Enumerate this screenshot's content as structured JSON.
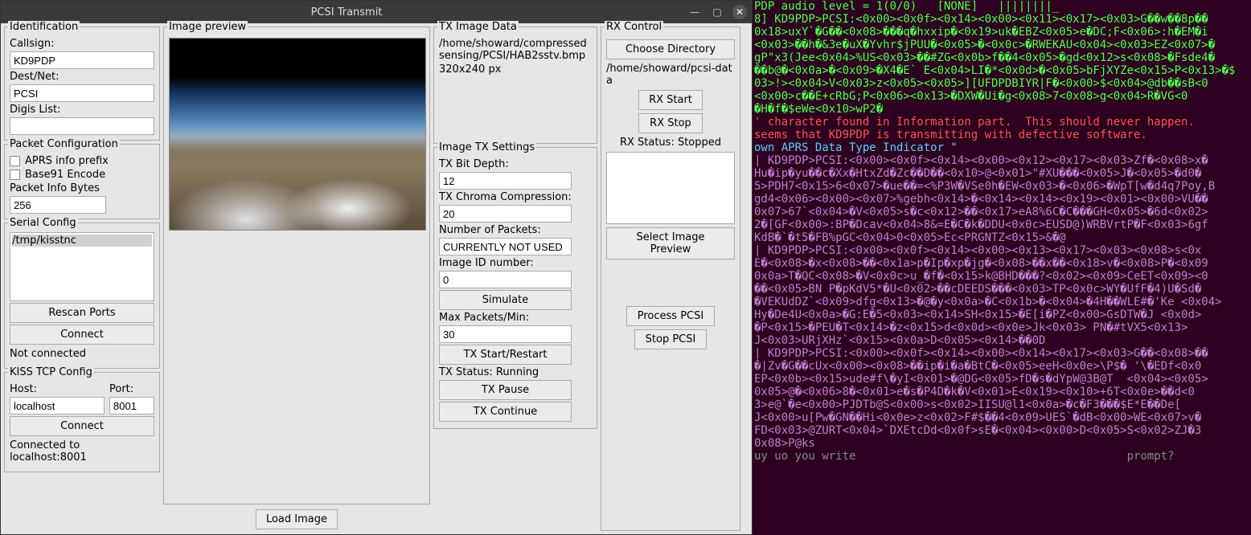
{
  "window": {
    "title": "PCSI Transmit",
    "min_icon": "—",
    "max_icon": "▢",
    "close_icon": "✕"
  },
  "identification": {
    "legend": "Identification",
    "callsign_label": "Callsign:",
    "callsign_value": "KD9PDP",
    "dest_label": "Dest/Net:",
    "dest_value": "PCSI",
    "digis_label": "Digis List:",
    "digis_value": ""
  },
  "packet_config": {
    "legend": "Packet Configuration",
    "aprs_prefix_label": "APRS info prefix",
    "aprs_prefix_checked": false,
    "base91_label": "Base91 Encode",
    "base91_checked": false,
    "info_bytes_label": "Packet Info Bytes",
    "info_bytes_value": "256"
  },
  "serial": {
    "legend": "Serial Config",
    "ports": [
      "/tmp/kisstnc"
    ],
    "rescan_label": "Rescan Ports",
    "connect_label": "Connect",
    "status": "Not connected"
  },
  "kiss": {
    "legend": "KISS TCP Config",
    "host_label": "Host:",
    "host_value": "localhost",
    "port_label": "Port:",
    "port_value": "8001",
    "connect_label": "Connect",
    "status": "Connected to localhost:8001"
  },
  "preview": {
    "legend": "Image preview",
    "load_label": "Load Image"
  },
  "tx_image": {
    "legend": "TX Image Data",
    "path": "/home/showard/compressedsensing/PCSI/HAB2sstv.bmp",
    "dims": "320x240 px"
  },
  "tx_settings": {
    "legend": "Image TX Settings",
    "bitdepth_label": "TX Bit Depth:",
    "bitdepth_value": "12",
    "chroma_label": "TX Chroma Compression:",
    "chroma_value": "20",
    "npackets_label": "Number of Packets:",
    "npackets_value": "CURRENTLY NOT USED",
    "imageid_label": "Image ID number:",
    "imageid_value": "0",
    "simulate_label": "Simulate",
    "maxpkts_label": "Max Packets/Min:",
    "maxpkts_value": "30",
    "txstart_label": "TX Start/Restart",
    "txstatus": "TX Status: Running",
    "txpause_label": "TX Pause",
    "txcontinue_label": "TX Continue"
  },
  "rx": {
    "legend": "RX Control",
    "choosedir_label": "Choose Directory",
    "dir": "/home/showard/pcsi-data",
    "rxstart_label": "RX Start",
    "rxstop_label": "RX Stop",
    "rxstatus": "RX Status: Stopped",
    "selprev_label": "Select Image Preview",
    "process_label": "Process PCSI",
    "stop_label": "Stop PCSI"
  },
  "terminal_lines": [
    {
      "cls": "green",
      "text": "PDP audio level = 1(0/0)   [NONE]   ||||||||_"
    },
    {
      "cls": "green",
      "text": "8] KD9PDP>PCSI:<0x00><0x0f><0x14><0x00><0x11><0x17><0x03>G��w��8p��"
    },
    {
      "cls": "green",
      "text": "0x18>uxY`�G��<0x08>���q�hxxip�<0x19>uk�EBZ<0x05>e�DC;F<0x06>:h�EM�i"
    },
    {
      "cls": "green",
      "text": "<0x03>��h�&3e�uX�Yvhr$jPUU�<0x05>�<0x0c>�RWEKAU<0x04><0x03>EZ<0x07>�"
    },
    {
      "cls": "green",
      "text": "gP\"x3(Jee<0x04>%US<0x03>��#ZG<0x0b>f��4<0x05>�gd<0x12>s<0x08>�Fsde4�"
    },
    {
      "cls": "green",
      "text": "��b@�<0x0a>�<0x09>�X4�E` E<0x04>LI�*<0x0d>�<0x05>bFjXYZe<0x15>P<0x13>�$"
    },
    {
      "cls": "green",
      "text": "03>!><0x04>V<0x03>z<0x05><0x05>][UFDPDBIYR|F�<0x00>$<0x04>@db��sB<0"
    },
    {
      "cls": "green",
      "text": "<0x00>c��E+cRbG;P<0x06><0x13>�DXW�Ui�g<0x08>7<0x08>g<0x04>R�VG<0"
    },
    {
      "cls": "green",
      "text": "�H�f�$eWe<0x10>wP2�"
    },
    {
      "cls": "red",
      "text": "' character found in Information part.  This should never happen."
    },
    {
      "cls": "red",
      "text": "seems that KD9PDP is transmitting with defective software."
    },
    {
      "cls": "cyan",
      "text": "own APRS Data Type Indicator \""
    },
    {
      "cls": "mag",
      "text": "| KD9PDP>PCSI:<0x00><0x0f><0x14><0x00><0x12><0x17><0x03>Zf�<0x08>x�"
    },
    {
      "cls": "mag",
      "text": "Hu�ip�yu��c�Xx�HtxZd�Zc��D��<0x10>@<0x01>\"#XU���<0x05>J�<0x05>�d0�"
    },
    {
      "cls": "mag",
      "text": "5>PDH7<0x15>6<0x07>�ue��=<%P3W�VSe0h�EW<0x03>�<0x06>�WpT[w�d4q7Poy,B"
    },
    {
      "cls": "mag",
      "text": "gd4<0x06><0x00><0x07>%gebh<0x14>�<0x14><0x14><0x19><0x01><0x00>VU��"
    },
    {
      "cls": "mag",
      "text": "0x07>67`<0x04>�V<0x05>s�c<0x12>��<0x17>eA8%6C�C���GH<0x05>�6d<0x02>"
    },
    {
      "cls": "mag",
      "text": "2�[GF<0x00>:BP�Dcav<0x04>8&=E�C�k�DDU<0x0c>EUSD@)WRBVrtP�F<0x03>6gf"
    },
    {
      "cls": "mag",
      "text": "KdB�`�t5�FB%pGC<0x04>0<0x05>Ec<PRGNTZ<0x15>&�@"
    },
    {
      "cls": "mag",
      "text": "| KD9PDP>PCSI:<0x00><0x0f><0x14><0x00><0x13><0x17><0x03><0x08>s<0x"
    },
    {
      "cls": "mag",
      "text": "E�<0x08>�x<0x08>��<0x1a>p�Ip�xp�jg�<0x08>��x��<0x18>v�<0x08>P�<0x09"
    },
    {
      "cls": "mag",
      "text": "0x0a>T�QC<0x08>�V<0x0c>u_�f�<0x15>k@BHD���?<0x02><0x09>CeET<0x09><0"
    },
    {
      "cls": "mag",
      "text": "��<0x05>BN P�pKdV5*�U<0x02>��cDEEDS���<0x03>TP<0x0c>WY�UfF�4)U�Sd�"
    },
    {
      "cls": "mag",
      "text": "�VEKUdDZ`<0x09>dfg<0x13>�@�y<0x0a>�C<0x1b>�<0x04>�4H��WLE#�'Ke <0x04>"
    },
    {
      "cls": "mag",
      "text": "Hy�De4U<0x0a>�G:E�5<0x03><0x14>SH<0x15>�E[i�PZ<0x00>GsDTW�J <0x0d>"
    },
    {
      "cls": "mag",
      "text": "�P<0x15>�PEU�T<0x14>�z<0x15>d<0x0d><0x0e>Jk<0x03> PN�#tVX5<0x13>"
    },
    {
      "cls": "mag",
      "text": "J<0x03>URjXHz`<0x15><0x0a>D<0x05><0x14>��0D"
    },
    {
      "cls": "mag",
      "text": "| KD9PDP>PCSI:<0x00><0x0f><0x14><0x00><0x14><0x17><0x03>G��<0x08>��"
    },
    {
      "cls": "mag",
      "text": "�|Zv�G��cUx<0x00><0x08>��ip�i�a�BtC�<0x05>eeH<0x0e>\\P$� '\\�EDf<0x0"
    },
    {
      "cls": "mag",
      "text": "EP<0x0b><0x15>ude#f\\�yI<0x01>�@DG<0x05>fD�s�dYpW@3B@T  <0x04><0x05>"
    },
    {
      "cls": "mag",
      "text": "0x05>@�<0x06>8�<0x01>e�s�P4D�k�V<0x01>E<0x19><0x10>+6T<0x0e>��d<0"
    },
    {
      "cls": "mag",
      "text": "3>e@`�e<0x00>PJDTb@S<0x00>s<0x02>IISU@l1<0x0a>�c�F3���$E*E��De["
    },
    {
      "cls": "mag",
      "text": "J<0x00>u[Pw�GN��Hi<0x0e>z<0x02>F#$��4<0x09>UES`�dB<0x00>WE<0x07>v�"
    },
    {
      "cls": "mag",
      "text": "FD<0x03>@ZURT<0x04>`DXEtcDd<0x0f>sE�<0x04><0x00>D<0x05>S<0x02>ZJ�3"
    },
    {
      "cls": "mag",
      "text": "0x08>P@ks"
    },
    {
      "cls": "faint",
      "text": "uy uo you write                                        prompt?"
    }
  ]
}
